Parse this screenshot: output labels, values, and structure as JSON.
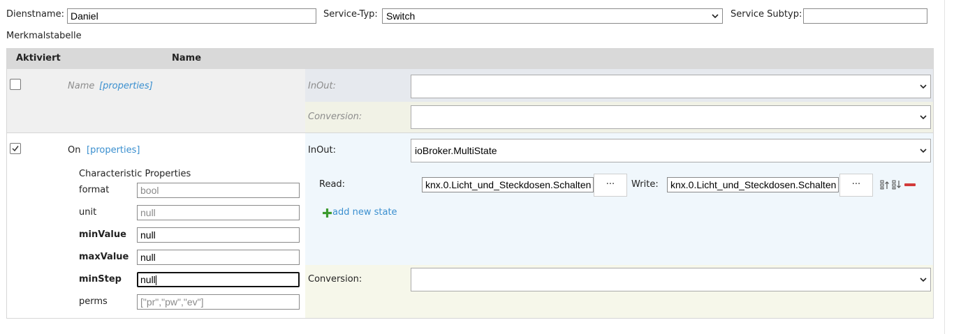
{
  "header": {
    "dienstname_label": "Dienstname:",
    "dienstname_value": "Daniel",
    "service_typ_label": "Service-Typ:",
    "service_typ_value": "Switch",
    "service_subtyp_label": "Service Subtyp:",
    "service_subtyp_value": ""
  },
  "table": {
    "caption": "Merkmalstabelle",
    "col_aktiviert": "Aktiviert",
    "col_name": "Name"
  },
  "row_name": {
    "checked": false,
    "name": "Name",
    "properties_link": "[properties]",
    "inout_label": "InOut:",
    "inout_value": "",
    "conversion_label": "Conversion:",
    "conversion_value": ""
  },
  "row_on": {
    "checked": true,
    "name": "On",
    "properties_link": "[properties]",
    "char_props_title": "Characteristic Properties",
    "props": [
      {
        "label": "format",
        "value": "bool",
        "bold": false,
        "placeholder": true
      },
      {
        "label": "unit",
        "value": "null",
        "bold": false,
        "placeholder": true
      },
      {
        "label": "minValue",
        "value": "null",
        "bold": true,
        "placeholder": false
      },
      {
        "label": "maxValue",
        "value": "null",
        "bold": true,
        "placeholder": false
      },
      {
        "label": "minStep",
        "value": "null",
        "bold": true,
        "placeholder": false
      },
      {
        "label": "perms",
        "value": "[\"pr\",\"pw\",\"ev\"]",
        "bold": false,
        "placeholder": true
      }
    ],
    "inout_label": "InOut:",
    "inout_value": "ioBroker.MultiState",
    "read_label": "Read:",
    "read_value": "knx.0.Licht_und_Steckdosen.Schalten",
    "write_label": "Write:",
    "write_value": "knx.0.Licht_und_Steckdosen.Schalten",
    "browse_button": "···",
    "add_state": "add new state",
    "conversion_label": "Conversion:",
    "conversion_value": ""
  },
  "colors": {
    "header_bg": "#d9d9d9",
    "row1_bg": "#f0f0f0",
    "inout_bg_row1": "#e6e9ee",
    "conv_bg": "#f1f2e6",
    "inout_bg_row2": "#f0f7fc",
    "link": "#3a8fcf",
    "add_icon": "#3c9a2e",
    "remove_icon": "#d23a3a"
  }
}
